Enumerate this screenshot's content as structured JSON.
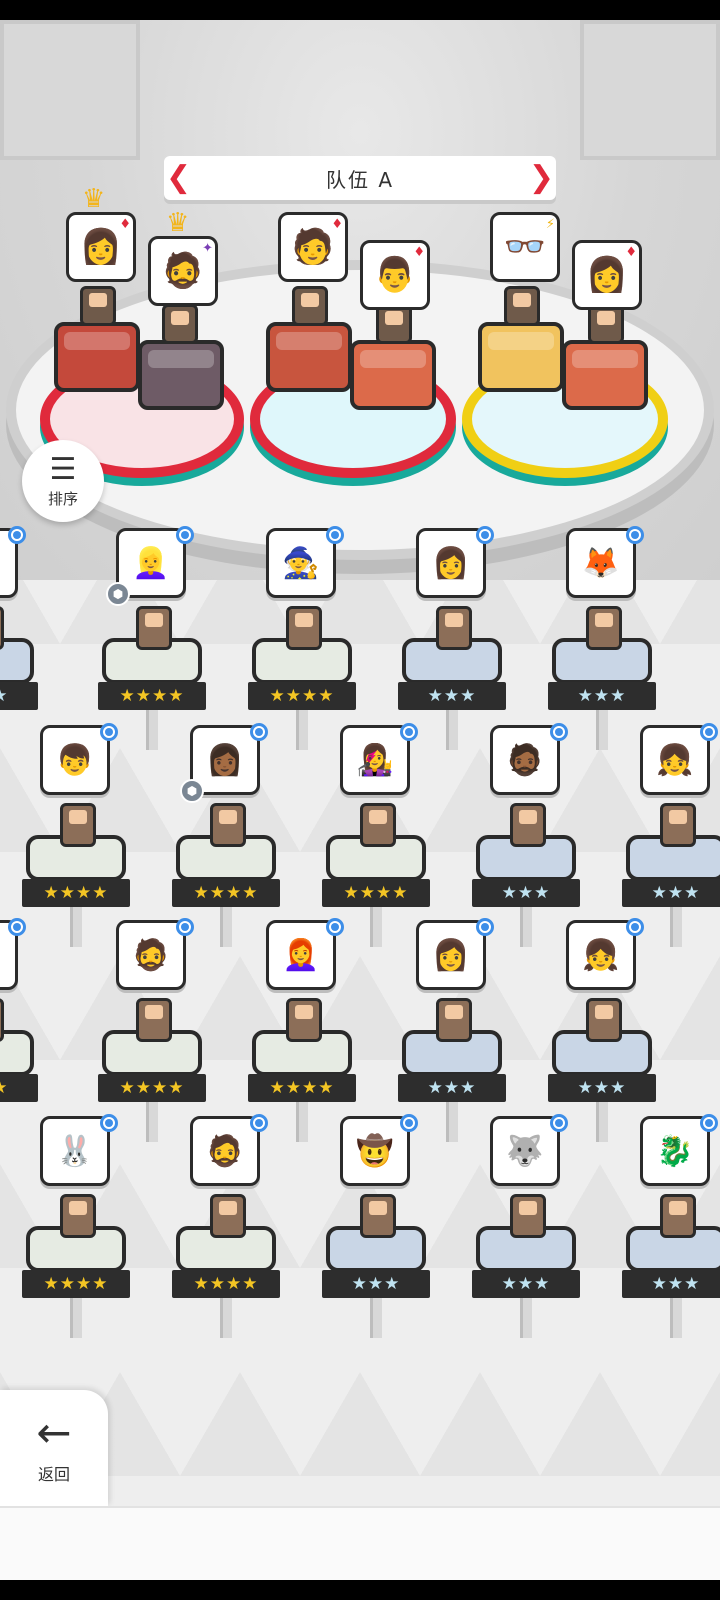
{
  "team": {
    "title": "队伍 A",
    "slots": [
      {
        "icon": "👩",
        "mark": "♦",
        "crown": true
      },
      {
        "icon": "🧔",
        "mark": "✦",
        "crown": true
      },
      {
        "icon": "🧑",
        "mark": "♦",
        "crown": false
      },
      {
        "icon": "👨",
        "mark": "♦",
        "crown": false
      },
      {
        "icon": "👓",
        "mark": "⚡",
        "crown": false
      },
      {
        "icon": "👩",
        "mark": "♦",
        "crown": false
      }
    ]
  },
  "sort_button": {
    "icon": "sort-icon",
    "label": "排序"
  },
  "back_button": {
    "icon": "arrow-left-icon",
    "label": "返回"
  },
  "heroes": [
    {
      "icon": "👧",
      "stars": "★★★",
      "tier": "silver"
    },
    {
      "icon": "👱‍♀️",
      "stars": "★★★★",
      "tier": "gold",
      "cube": true
    },
    {
      "icon": "🧙",
      "stars": "★★★★",
      "tier": "gold"
    },
    {
      "icon": "👩",
      "stars": "★★★",
      "tier": "silver"
    },
    {
      "icon": "🦊",
      "stars": "★★★",
      "tier": "silver"
    },
    {
      "icon": "👦",
      "stars": "★★★★",
      "tier": "gold"
    },
    {
      "icon": "👩🏾",
      "stars": "★★★★",
      "tier": "gold",
      "cube": true
    },
    {
      "icon": "👩‍🎤",
      "stars": "★★★★",
      "tier": "gold"
    },
    {
      "icon": "🧔🏾",
      "stars": "★★★",
      "tier": "silver"
    },
    {
      "icon": "👧",
      "stars": "★★★",
      "tier": "silver"
    },
    {
      "icon": "👱",
      "stars": "★★★",
      "tier": "gold"
    },
    {
      "icon": "🧔",
      "stars": "★★★★",
      "tier": "gold"
    },
    {
      "icon": "👩‍🦰",
      "stars": "★★★★",
      "tier": "gold"
    },
    {
      "icon": "👩",
      "stars": "★★★",
      "tier": "silver"
    },
    {
      "icon": "👧",
      "stars": "★★★",
      "tier": "silver"
    },
    {
      "icon": "🐰",
      "stars": "★★★★",
      "tier": "gold"
    },
    {
      "icon": "🧔",
      "stars": "★★★★",
      "tier": "gold"
    },
    {
      "icon": "🤠",
      "stars": "★★★",
      "tier": "silver"
    },
    {
      "icon": "🐺",
      "stars": "★★★",
      "tier": "silver"
    },
    {
      "icon": "🐉",
      "stars": "★★★",
      "tier": "silver"
    }
  ]
}
